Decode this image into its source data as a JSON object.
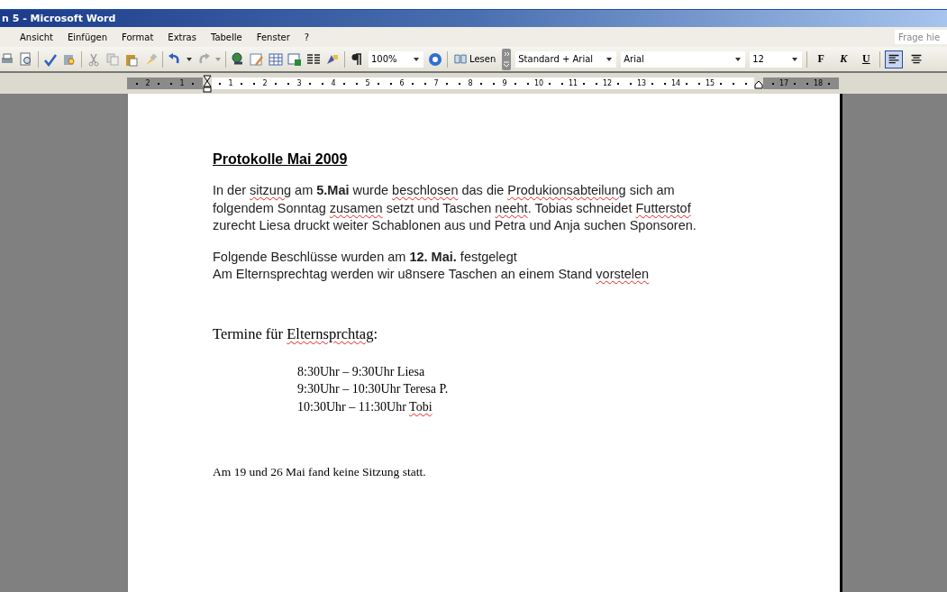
{
  "window": {
    "title": "n 5 - Microsoft Word"
  },
  "menu": [
    {
      "label": "Ansicht"
    },
    {
      "label": "Einfügen"
    },
    {
      "label": "Format"
    },
    {
      "label": "Extras"
    },
    {
      "label": "Tabelle"
    },
    {
      "label": "Fenster"
    },
    {
      "label": "?"
    }
  ],
  "help_field": {
    "placeholder": "Frage hie"
  },
  "toolbar": {
    "zoom": "100%",
    "read_button": "Lesen",
    "style": "Standard + Arial",
    "font": "Arial",
    "size": "12",
    "format_buttons": [
      {
        "label": "F",
        "kind": "bold",
        "selected": false
      },
      {
        "label": "K",
        "kind": "italic",
        "selected": false
      },
      {
        "label": "U",
        "kind": "underline",
        "selected": false
      }
    ],
    "align_left": {
      "selected": true
    }
  },
  "ruler": {
    "left_labels": [
      "2",
      "1"
    ],
    "labels": [
      "1",
      "2",
      "3",
      "4",
      "5",
      "6",
      "7",
      "8",
      "9",
      "10",
      "11",
      "12",
      "13",
      "14",
      "15"
    ],
    "right_labels": [
      "17",
      "18"
    ]
  },
  "document": [
    {
      "kind": "heading",
      "lines": [
        [
          {
            "text": "Protokolle Mai 2009"
          }
        ]
      ]
    },
    {
      "kind": "sans",
      "lines": [
        [
          {
            "text": "In der "
          },
          {
            "text": "sitzung",
            "misspelled": true
          },
          {
            "text": " am **5.Mai** wurde "
          },
          {
            "text": "beschlosen",
            "misspelled": true
          },
          {
            "text": " das die "
          },
          {
            "text": "Produkionsabteilung",
            "misspelled": true
          },
          {
            "text": " sich am"
          }
        ],
        [
          {
            "text": "folgendem Sonntag "
          },
          {
            "text": "zusamen",
            "misspelled": true
          },
          {
            "text": " setzt und Taschen "
          },
          {
            "text": "neeht",
            "misspelled": true
          },
          {
            "text": ". Tobias schneidet "
          },
          {
            "text": "Futterstof",
            "misspelled": true
          }
        ],
        [
          {
            "text": "zurecht Liesa druckt weiter Schablonen aus und Petra und Anja suchen Sponsoren."
          }
        ]
      ]
    },
    {
      "kind": "sans",
      "lines": [
        [
          {
            "text": "Folgende Beschlüsse wurden am **12. Mai.** festgelegt"
          }
        ],
        [
          {
            "text": "Am Elternsprechtag werden wir u8nsere Taschen an einem Stand "
          },
          {
            "text": "vorstelen",
            "misspelled": true
          }
        ]
      ]
    },
    {
      "kind": "serif_heading",
      "lines": [
        [
          {
            "text": "Termine für "
          },
          {
            "text": "Elternsprchtag",
            "misspelled": true
          },
          {
            "text": ":"
          }
        ]
      ]
    },
    {
      "kind": "indented",
      "lines": [
        [
          {
            "text": "8:30Uhr – 9:30Uhr Liesa"
          }
        ],
        [
          {
            "text": "9:30Uhr – 10:30Uhr Teresa P."
          }
        ],
        [
          {
            "text": "10:30Uhr – 11:30Uhr "
          },
          {
            "text": "Tobi",
            "misspelled": true
          }
        ]
      ]
    },
    {
      "kind": "serif",
      "lines": [
        [
          {
            "text": "Am  19 und 26 Mai fand keine Sitzung statt."
          }
        ]
      ]
    }
  ]
}
